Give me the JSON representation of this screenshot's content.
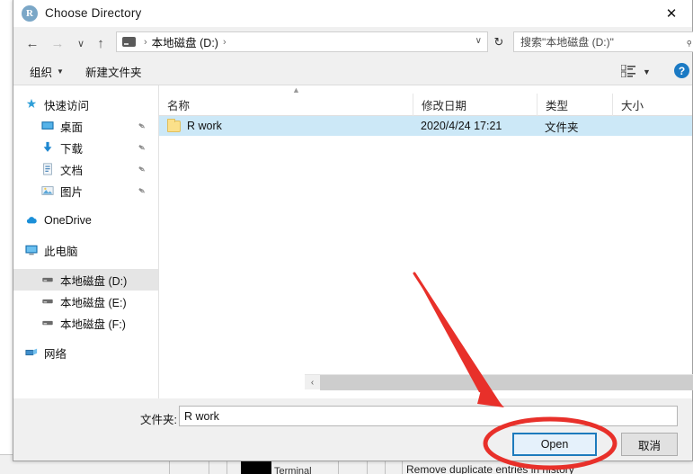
{
  "window": {
    "title": "Choose Directory",
    "app_icon": "r-logo-icon",
    "close_label": "✕"
  },
  "nav": {
    "back_icon": "←",
    "forward_icon": "→",
    "recent_icon": "∨",
    "up_icon": "↑",
    "refresh_icon": "↻",
    "address": {
      "drive_icon": "drive-icon",
      "separator": "›",
      "crumb": "本地磁盘 (D:)",
      "dropdown_icon": "∨"
    },
    "search": {
      "placeholder": "搜索\"本地磁盘 (D:)\"",
      "icon": "⌕"
    }
  },
  "commandbar": {
    "organize": "组织",
    "new_folder": "新建文件夹",
    "caret": "▼",
    "view_caret": "▼",
    "help": "?"
  },
  "sidebar": {
    "items": [
      {
        "label": "快速访问",
        "icon": "star-pin-icon",
        "level": 0,
        "pinned": false,
        "selected": false
      },
      {
        "label": "桌面",
        "icon": "desktop-icon",
        "level": 1,
        "pinned": true,
        "selected": false
      },
      {
        "label": "下载",
        "icon": "download-icon",
        "level": 1,
        "pinned": true,
        "selected": false
      },
      {
        "label": "文档",
        "icon": "documents-icon",
        "level": 1,
        "pinned": true,
        "selected": false
      },
      {
        "label": "图片",
        "icon": "pictures-icon",
        "level": 1,
        "pinned": true,
        "selected": false
      },
      {
        "label": "OneDrive",
        "icon": "cloud-icon",
        "level": 0,
        "pinned": false,
        "selected": false
      },
      {
        "label": "此电脑",
        "icon": "this-pc-icon",
        "level": 0,
        "pinned": false,
        "selected": false
      },
      {
        "label": "本地磁盘 (D:)",
        "icon": "drive-icon",
        "level": 1,
        "pinned": false,
        "selected": true
      },
      {
        "label": "本地磁盘 (E:)",
        "icon": "drive-icon",
        "level": 1,
        "pinned": false,
        "selected": false
      },
      {
        "label": "本地磁盘 (F:)",
        "icon": "drive-icon",
        "level": 1,
        "pinned": false,
        "selected": false
      },
      {
        "label": "网络",
        "icon": "network-icon",
        "level": 0,
        "pinned": false,
        "selected": false
      }
    ]
  },
  "filelist": {
    "sort_indicator": "▲",
    "columns": [
      {
        "label": "名称"
      },
      {
        "label": "修改日期"
      },
      {
        "label": "类型"
      },
      {
        "label": "大小"
      }
    ],
    "rows": [
      {
        "name": "R work",
        "date": "2020/4/24 17:21",
        "type": "文件夹",
        "size": "",
        "icon": "folder-icon",
        "selected": true
      }
    ],
    "scroll_left_icon": "‹",
    "scroll_right_icon": "›"
  },
  "footer": {
    "folder_label": "文件夹:",
    "folder_value": "R work",
    "folder_placeholder": "",
    "open_button": "Open",
    "cancel_button": "取消"
  },
  "annotations": {
    "arrow_color": "#e8302a",
    "ellipse_color": "#e8302a"
  },
  "background_app": {
    "terminal_label": "Terminal",
    "history_label": "Remove duplicate entries in history"
  }
}
